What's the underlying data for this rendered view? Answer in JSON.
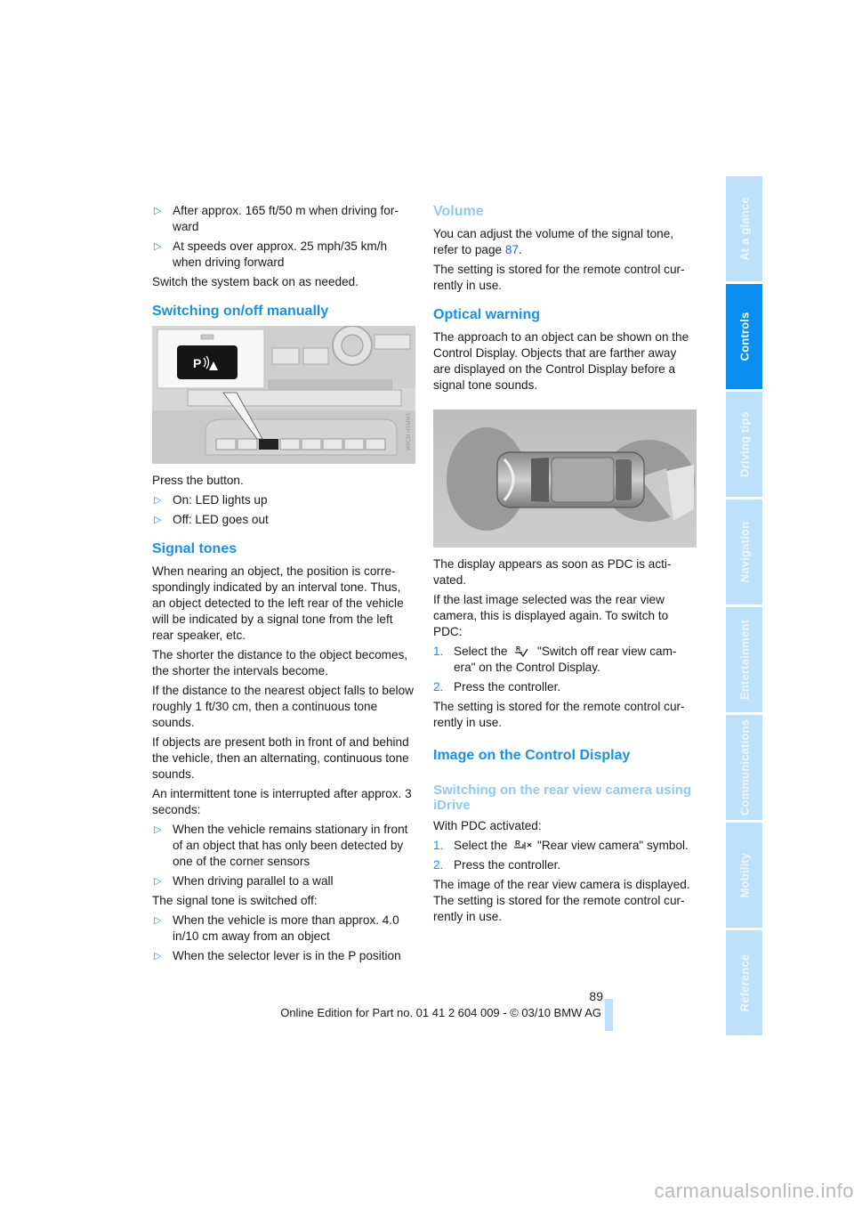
{
  "page": {
    "number": "89",
    "footer": "Online Edition for Part no. 01 41 2 604 009 - © 03/10 BMW AG",
    "watermark": "carmanualsonline.info"
  },
  "colors": {
    "accent": "#1a8fe8",
    "heading_light": "#8ec8f4",
    "tab_active": "#0a8ef0",
    "tab_inactive": "#bde0fb"
  },
  "side_tabs": [
    {
      "label": "At a glance",
      "active": false
    },
    {
      "label": "Controls",
      "active": true
    },
    {
      "label": "Driving tips",
      "active": false
    },
    {
      "label": "Navigation",
      "active": false
    },
    {
      "label": "Entertainment",
      "active": false
    },
    {
      "label": "Communications",
      "active": false
    },
    {
      "label": "Mobility",
      "active": false
    },
    {
      "label": "Reference",
      "active": false
    }
  ],
  "left": {
    "intro_bullets": [
      "After approx. 165 ft/50 m when driving for-ward",
      "At speeds over approx. 25 mph/35 km/h when driving forward"
    ],
    "intro_text": "Switch the system back on as needed.",
    "manual_heading": "Switching on/off manually",
    "figure_console_alt": "PDC button on center console",
    "figure_console_code": "W8CM HSMMS",
    "press_text": "Press the button.",
    "press_bullets": [
      "On: LED lights up",
      "Off: LED goes out"
    ],
    "signal_heading": "Signal tones",
    "signal_paragraphs": [
      "When nearing an object, the position is corre-spondingly indicated by an interval tone. Thus, an object detected to the left rear of the vehicle will be indicated by a signal tone from the left rear speaker, etc.",
      "The shorter the distance to the object becomes, the shorter the intervals become.",
      "If the distance to the nearest object falls to below roughly 1 ft/30 cm, then a continuous tone sounds.",
      "If objects are present both in front of and behind the vehicle, then an alternating, continuous tone sounds.",
      "An intermittent tone is interrupted after approx. 3 seconds:"
    ],
    "interrupt_bullets": [
      "When the vehicle remains stationary in front of an object that has only been detected by one of the corner sensors",
      "When driving parallel to a wall"
    ],
    "switched_off_text": "The signal tone is switched off:",
    "switched_off_bullets": [
      "When the vehicle is more than approx. 4.0 in/10 cm away from an object",
      "When the selector lever is in the P position"
    ]
  },
  "right": {
    "volume_heading": "Volume",
    "volume_text_before": "You can adjust the volume of the signal tone, refer to page ",
    "volume_link": "87",
    "volume_text_after": ".",
    "volume_stored": "The setting is stored for the remote control cur-rently in use.",
    "optical_heading": "Optical warning",
    "optical_text": "The approach to an object can be shown on the Control Display. Objects that are farther away are displayed on the Control Display before a signal tone sounds.",
    "figure_pdc_alt": "PDC display with vehicle top view",
    "display_text": "The display appears as soon as PDC is acti-vated.",
    "last_image_text": "If the last image selected was the rear view camera, this is displayed again. To switch to PDC:",
    "steps_pdc": [
      {
        "num": "1.",
        "before": "Select the ",
        "after": " \"Switch off rear view cam-era\" on the Control Display.",
        "icon": "camera-off-icon"
      },
      {
        "num": "2.",
        "before": "Press the controller.",
        "after": "",
        "icon": ""
      }
    ],
    "stored_text": "The setting is stored for the remote control cur-rently in use.",
    "image_heading": "Image on the Control Display",
    "camera_subheading": "Switching on the rear view camera using iDrive",
    "with_pdc": "With PDC activated:",
    "steps_camera": [
      {
        "num": "1.",
        "before": "Select the ",
        "after": " \"Rear view camera\" symbol.",
        "icon": "rear-camera-icon"
      },
      {
        "num": "2.",
        "before": "Press the controller.",
        "after": "",
        "icon": ""
      }
    ],
    "camera_displayed": "The image of the rear view camera is displayed.",
    "camera_stored": "The setting is stored for the remote control cur-rently in use."
  }
}
